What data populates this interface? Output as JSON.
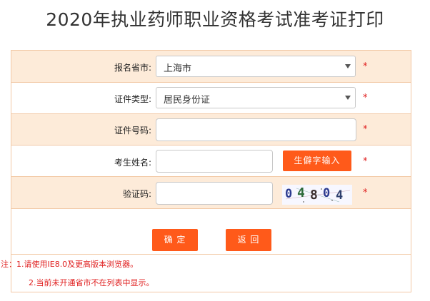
{
  "page": {
    "title": "2020年执业药师职业资格考试准考证打印"
  },
  "form": {
    "province": {
      "label": "报名省市:",
      "value": "上海市"
    },
    "id_type": {
      "label": "证件类型:",
      "value": "居民身份证"
    },
    "id_number": {
      "label": "证件号码:",
      "value": ""
    },
    "name": {
      "label": "考生姓名:",
      "value": "",
      "rare_char_button": "生僻字输入"
    },
    "captcha": {
      "label": "验证码:",
      "value": "",
      "image_text": "04804"
    },
    "required_mark": "*"
  },
  "actions": {
    "confirm_label": "确 定",
    "back_label": "返 回"
  },
  "notes": {
    "line1": "注：1.请使用IE8.0及更高版本浏览器。",
    "line2": "2.当前未开通省市不在列表中显示。"
  },
  "colors": {
    "accent": "#ff5a1a",
    "row_alt": "#fdebd9",
    "border": "#f2c9a6",
    "required": "#e02020"
  }
}
